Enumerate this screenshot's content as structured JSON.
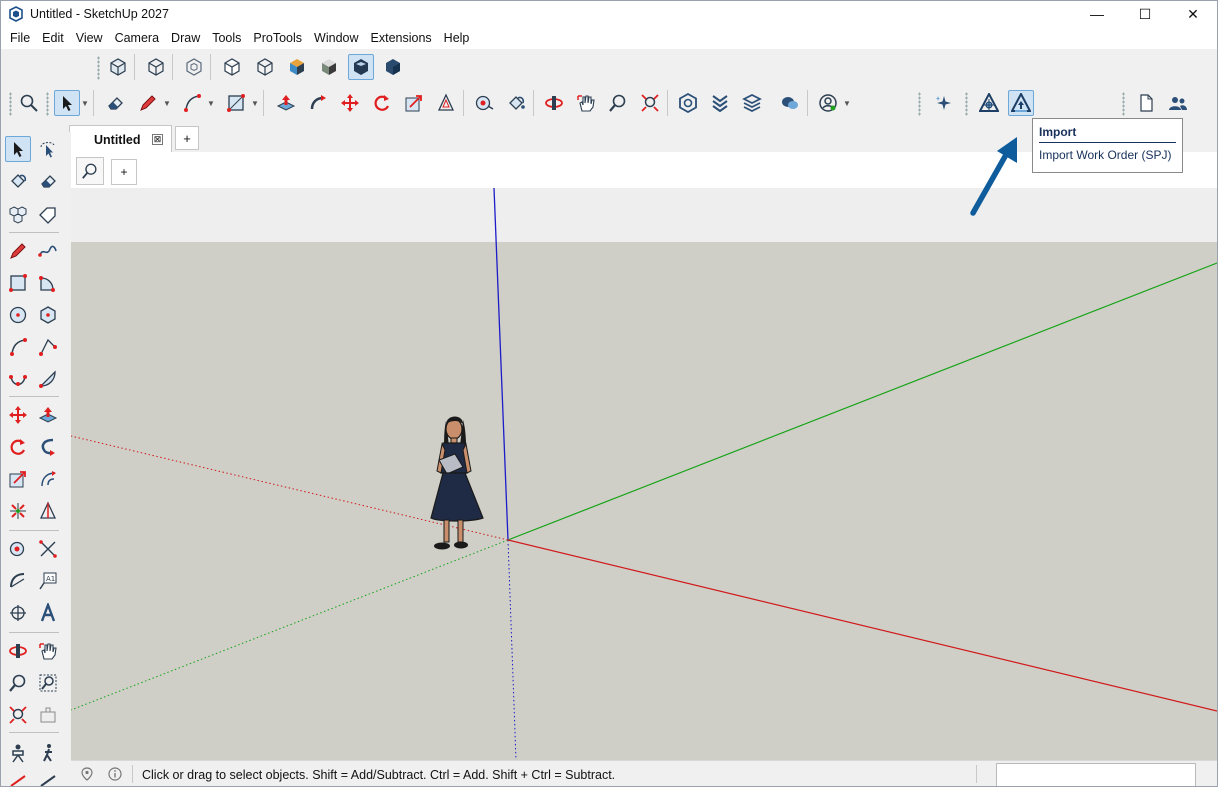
{
  "window": {
    "title": "Untitled - SketchUp 2027",
    "minimize": "—",
    "maximize": "☐",
    "close": "✕"
  },
  "menu": [
    "File",
    "Edit",
    "View",
    "Camera",
    "Draw",
    "Tools",
    "ProTools",
    "Window",
    "Extensions",
    "Help"
  ],
  "tabs": {
    "active_tab": "Untitled",
    "close_glyph": "⊠",
    "add_glyph": "+"
  },
  "viewport_controls": {
    "add_glyph": "+"
  },
  "tooltip": {
    "title": "Import",
    "body": "Import Work Order (SPJ)"
  },
  "status": {
    "hint": "Click or drag to select objects. Shift = Add/Subtract. Ctrl = Add. Shift + Ctrl = Subtract."
  },
  "colors": {
    "axis_red": "#d11a1a",
    "axis_green": "#16a316",
    "axis_blue": "#1c1cc8",
    "sky": "#f0f0f0",
    "ground": "#cfcfc8",
    "arrow": "#0e5c9c"
  }
}
